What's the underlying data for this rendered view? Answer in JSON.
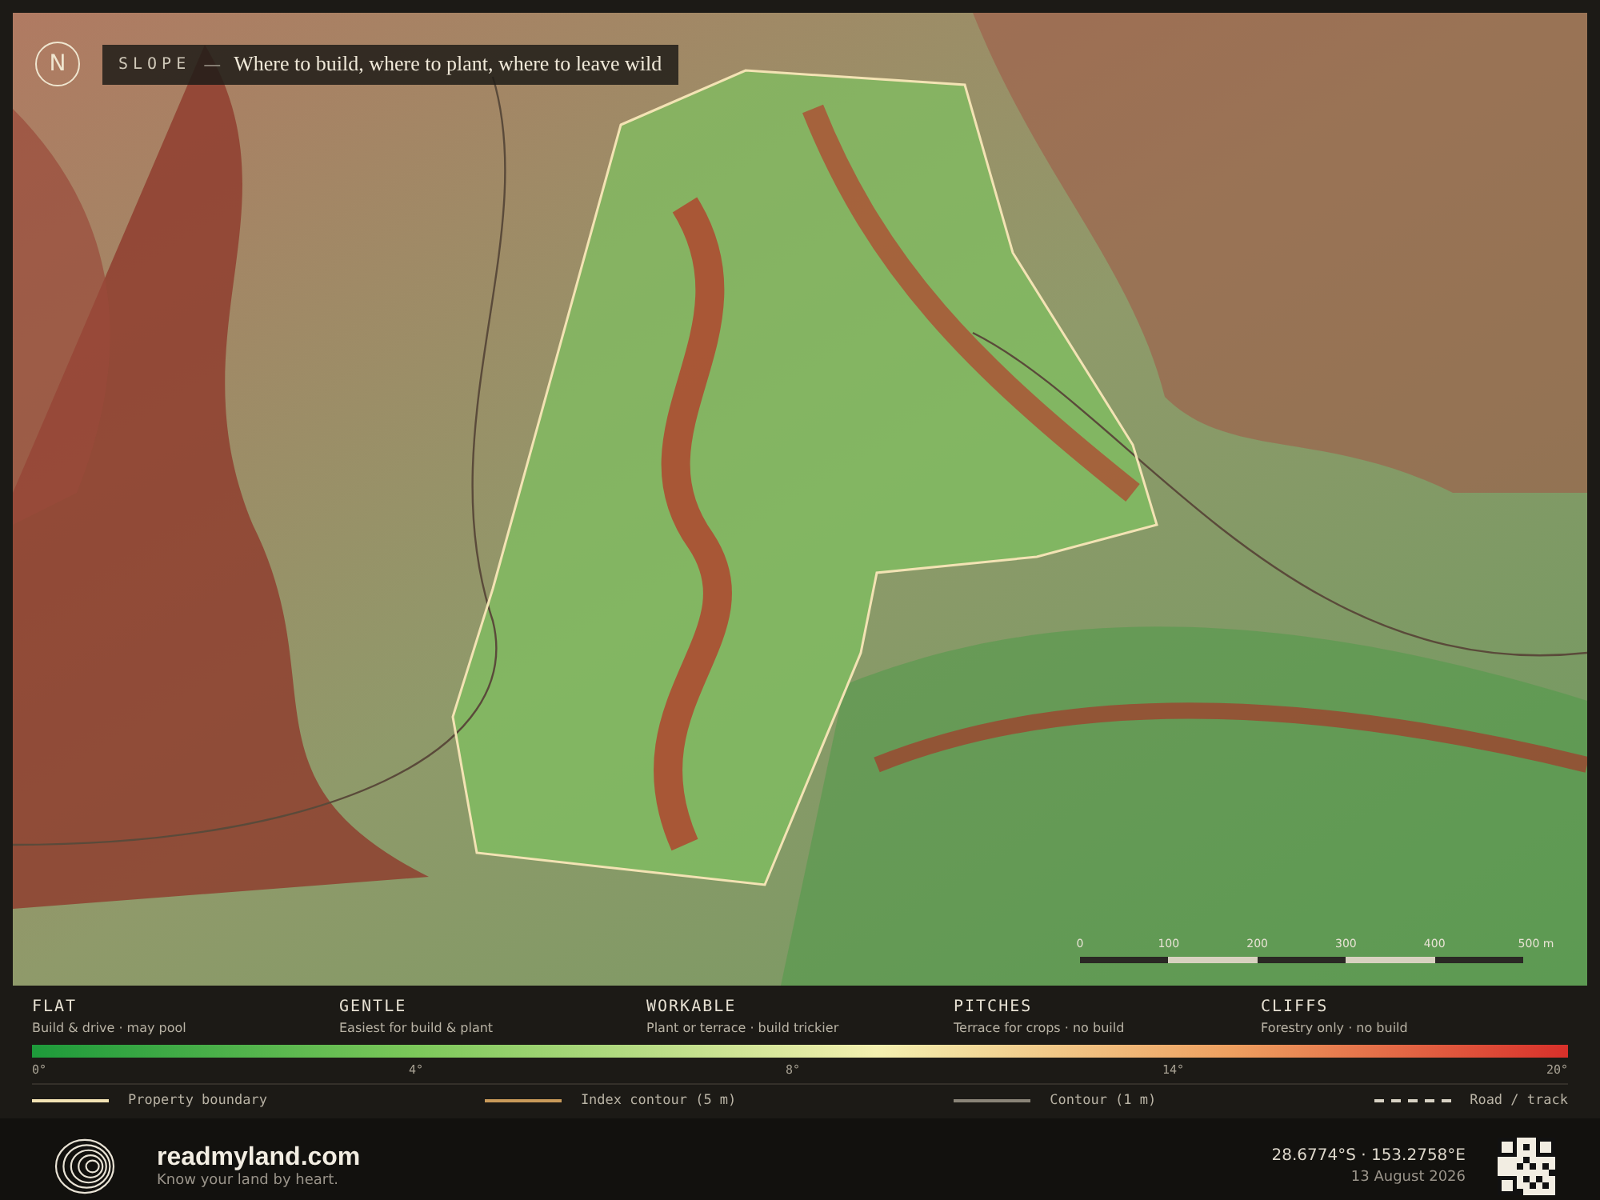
{
  "map": {
    "compass": "N",
    "layer": "SLOPE",
    "dash": "—",
    "subtitle": "Where to build, where to plant, where to leave wild",
    "scale_ticks": [
      "0",
      "100",
      "200",
      "300",
      "400",
      "500 m"
    ]
  },
  "legend": {
    "classes": [
      {
        "name": "FLAT",
        "description": "Build & drive · may pool"
      },
      {
        "name": "GENTLE",
        "description": "Easiest for build & plant"
      },
      {
        "name": "WORKABLE",
        "description": "Plant or terrace · build trickier"
      },
      {
        "name": "PITCHES",
        "description": "Terrace for crops · no build"
      },
      {
        "name": "CLIFFS",
        "description": "Forestry only · no build"
      }
    ],
    "ticks": [
      "0°",
      "4°",
      "8°",
      "14°",
      "20°"
    ],
    "lines": [
      {
        "kind": "solid",
        "color": "#f3e3b4",
        "label": "Property boundary"
      },
      {
        "kind": "solid",
        "color": "#c99a5a",
        "label": "Index contour (5 m)"
      },
      {
        "kind": "solid",
        "color": "#8a8478",
        "label": "Contour (1 m)"
      },
      {
        "kind": "dashed",
        "color": "#d8d2c4",
        "label": "Road / track"
      }
    ]
  },
  "footer": {
    "site": "readmyland.com",
    "tagline": "Know your land by heart.",
    "coordinates": "28.6774°S · 153.2758°E",
    "date": "13 August 2026"
  }
}
